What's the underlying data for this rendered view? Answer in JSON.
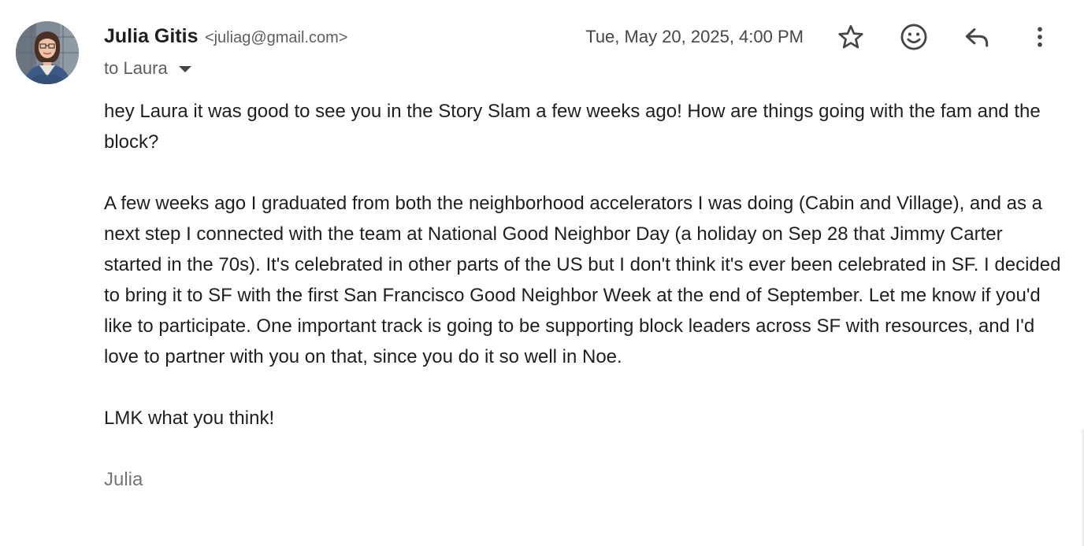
{
  "sender": {
    "name": "Julia Gitis",
    "email": "<juliag@gmail.com>"
  },
  "recipient": {
    "label": "to Laura"
  },
  "date": "Tue, May 20, 2025, 4:00 PM",
  "actions": {
    "star": "star-icon",
    "emoji": "emoji-icon",
    "reply": "reply-icon",
    "more": "more-vert-icon"
  },
  "body": {
    "paragraphs": [
      "hey Laura it was good to see you in the Story Slam a few weeks ago! How are things going with the fam and the block?",
      "A few weeks ago I graduated from both the neighborhood accelerators I was doing (Cabin and Village), and as a next step I connected with the team at National Good Neighbor Day (a holiday on Sep 28 that Jimmy Carter started in the 70s). It's celebrated in other parts of the US but I don't think it's ever been celebrated in SF. I decided to bring it to SF with the first San Francisco Good Neighbor Week at the end of September. Let me know if you'd like to participate. One important track is going to be supporting block leaders across SF with resources, and I'd love to partner with you on that, since you do it so well in Noe.",
      "LMK what you think!"
    ],
    "signature": "Julia"
  },
  "colors": {
    "text": "#1f1f1f",
    "secondary": "#5e5e5e",
    "signature": "#757575"
  }
}
